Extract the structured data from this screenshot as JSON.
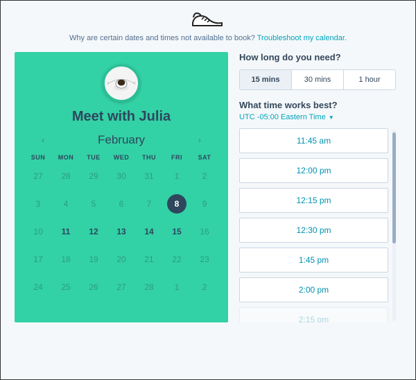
{
  "troubleshoot": {
    "prefix": "Why are certain dates and times not available to book? ",
    "link": "Troubleshoot my calendar.",
    "logo_alt": "shoe-logo"
  },
  "cal": {
    "meet_title": "Meet with Julia",
    "month": "February",
    "dow": [
      "SUN",
      "MON",
      "TUE",
      "WED",
      "THU",
      "FRI",
      "SAT"
    ],
    "weeks": [
      [
        {
          "n": "27",
          "f": true
        },
        {
          "n": "28",
          "f": true
        },
        {
          "n": "29",
          "f": true
        },
        {
          "n": "30",
          "f": true
        },
        {
          "n": "31",
          "f": true
        },
        {
          "n": "1",
          "f": true
        },
        {
          "n": "2",
          "f": true
        }
      ],
      [
        {
          "n": "3",
          "f": true
        },
        {
          "n": "4",
          "f": true
        },
        {
          "n": "5",
          "f": true
        },
        {
          "n": "6",
          "f": true
        },
        {
          "n": "7",
          "f": true
        },
        {
          "n": "8",
          "sel": true
        },
        {
          "n": "9",
          "f": true
        }
      ],
      [
        {
          "n": "10",
          "f": true
        },
        {
          "n": "11",
          "b": true
        },
        {
          "n": "12",
          "b": true
        },
        {
          "n": "13",
          "b": true
        },
        {
          "n": "14",
          "b": true
        },
        {
          "n": "15",
          "b": true
        },
        {
          "n": "16",
          "f": true
        }
      ],
      [
        {
          "n": "17",
          "f": true
        },
        {
          "n": "18",
          "f": true
        },
        {
          "n": "19",
          "f": true
        },
        {
          "n": "20",
          "f": true
        },
        {
          "n": "21",
          "f": true
        },
        {
          "n": "22",
          "f": true
        },
        {
          "n": "23",
          "f": true
        }
      ],
      [
        {
          "n": "24",
          "f": true
        },
        {
          "n": "25",
          "f": true
        },
        {
          "n": "26",
          "f": true
        },
        {
          "n": "27",
          "f": true
        },
        {
          "n": "28",
          "f": true
        },
        {
          "n": "1",
          "f": true
        },
        {
          "n": "2",
          "f": true
        }
      ]
    ]
  },
  "right": {
    "q1": "How long do you need?",
    "durations": [
      "15 mins",
      "30 mins",
      "1 hour"
    ],
    "duration_selected": 0,
    "q2": "What time works best?",
    "tz": "UTC -05:00 Eastern Time",
    "slots": [
      "11:45 am",
      "12:00 pm",
      "12:15 pm",
      "12:30 pm",
      "1:45 pm",
      "2:00 pm",
      "2:15 pm"
    ]
  }
}
